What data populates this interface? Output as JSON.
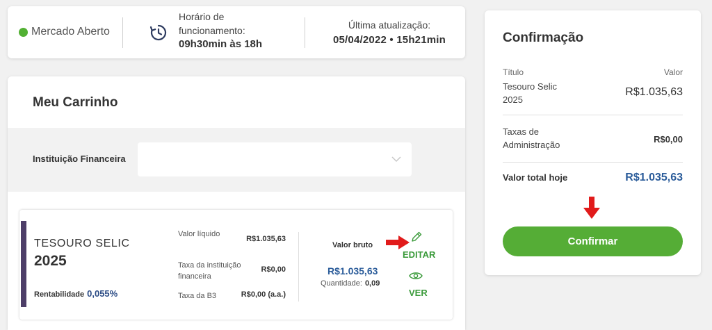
{
  "status_bar": {
    "market_status": "Mercado Aberto",
    "hours_label_line1": "Horário de",
    "hours_label_line2": "funcionamento:",
    "hours_value": "09h30min às 18h",
    "updated_label": "Última atualização:",
    "updated_value": "05/04/2022 • 15h21min",
    "status_color": "#52b033"
  },
  "cart": {
    "title": "Meu Carrinho",
    "institution_label": "Instituição Financeira",
    "institution_value": "",
    "item": {
      "name": "TESOURO SELIC",
      "year": "2025",
      "rent_label": "Rentabilidade",
      "rent_value": "0,055%",
      "liquid_label": "Valor líquido",
      "liquid_value": "R$1.035,63",
      "inst_fee_label": "Taxa da instituição financeira",
      "inst_fee_value": "R$0,00",
      "b3_fee_label": "Taxa da B3",
      "b3_fee_value": "R$0,00 (a.a.)",
      "gross_label": "Valor bruto",
      "gross_value": "R$1.035,63",
      "qty_label": "Quantidade:",
      "qty_value": "0,09",
      "edit_label": "EDITAR",
      "view_label": "VER"
    }
  },
  "confirmation": {
    "title": "Confirmação",
    "col_title": "Título",
    "col_value": "Valor",
    "title_name_line1": "Tesouro Selic",
    "title_name_line2": "2025",
    "title_value": "R$1.035,63",
    "admin_label_line1": "Taxas de",
    "admin_label_line2": "Administração",
    "admin_value": "R$0,00",
    "total_label": "Valor total hoje",
    "total_value": "R$1.035,63",
    "confirm_button": "Confirmar",
    "accent_color": "#55ad36"
  }
}
